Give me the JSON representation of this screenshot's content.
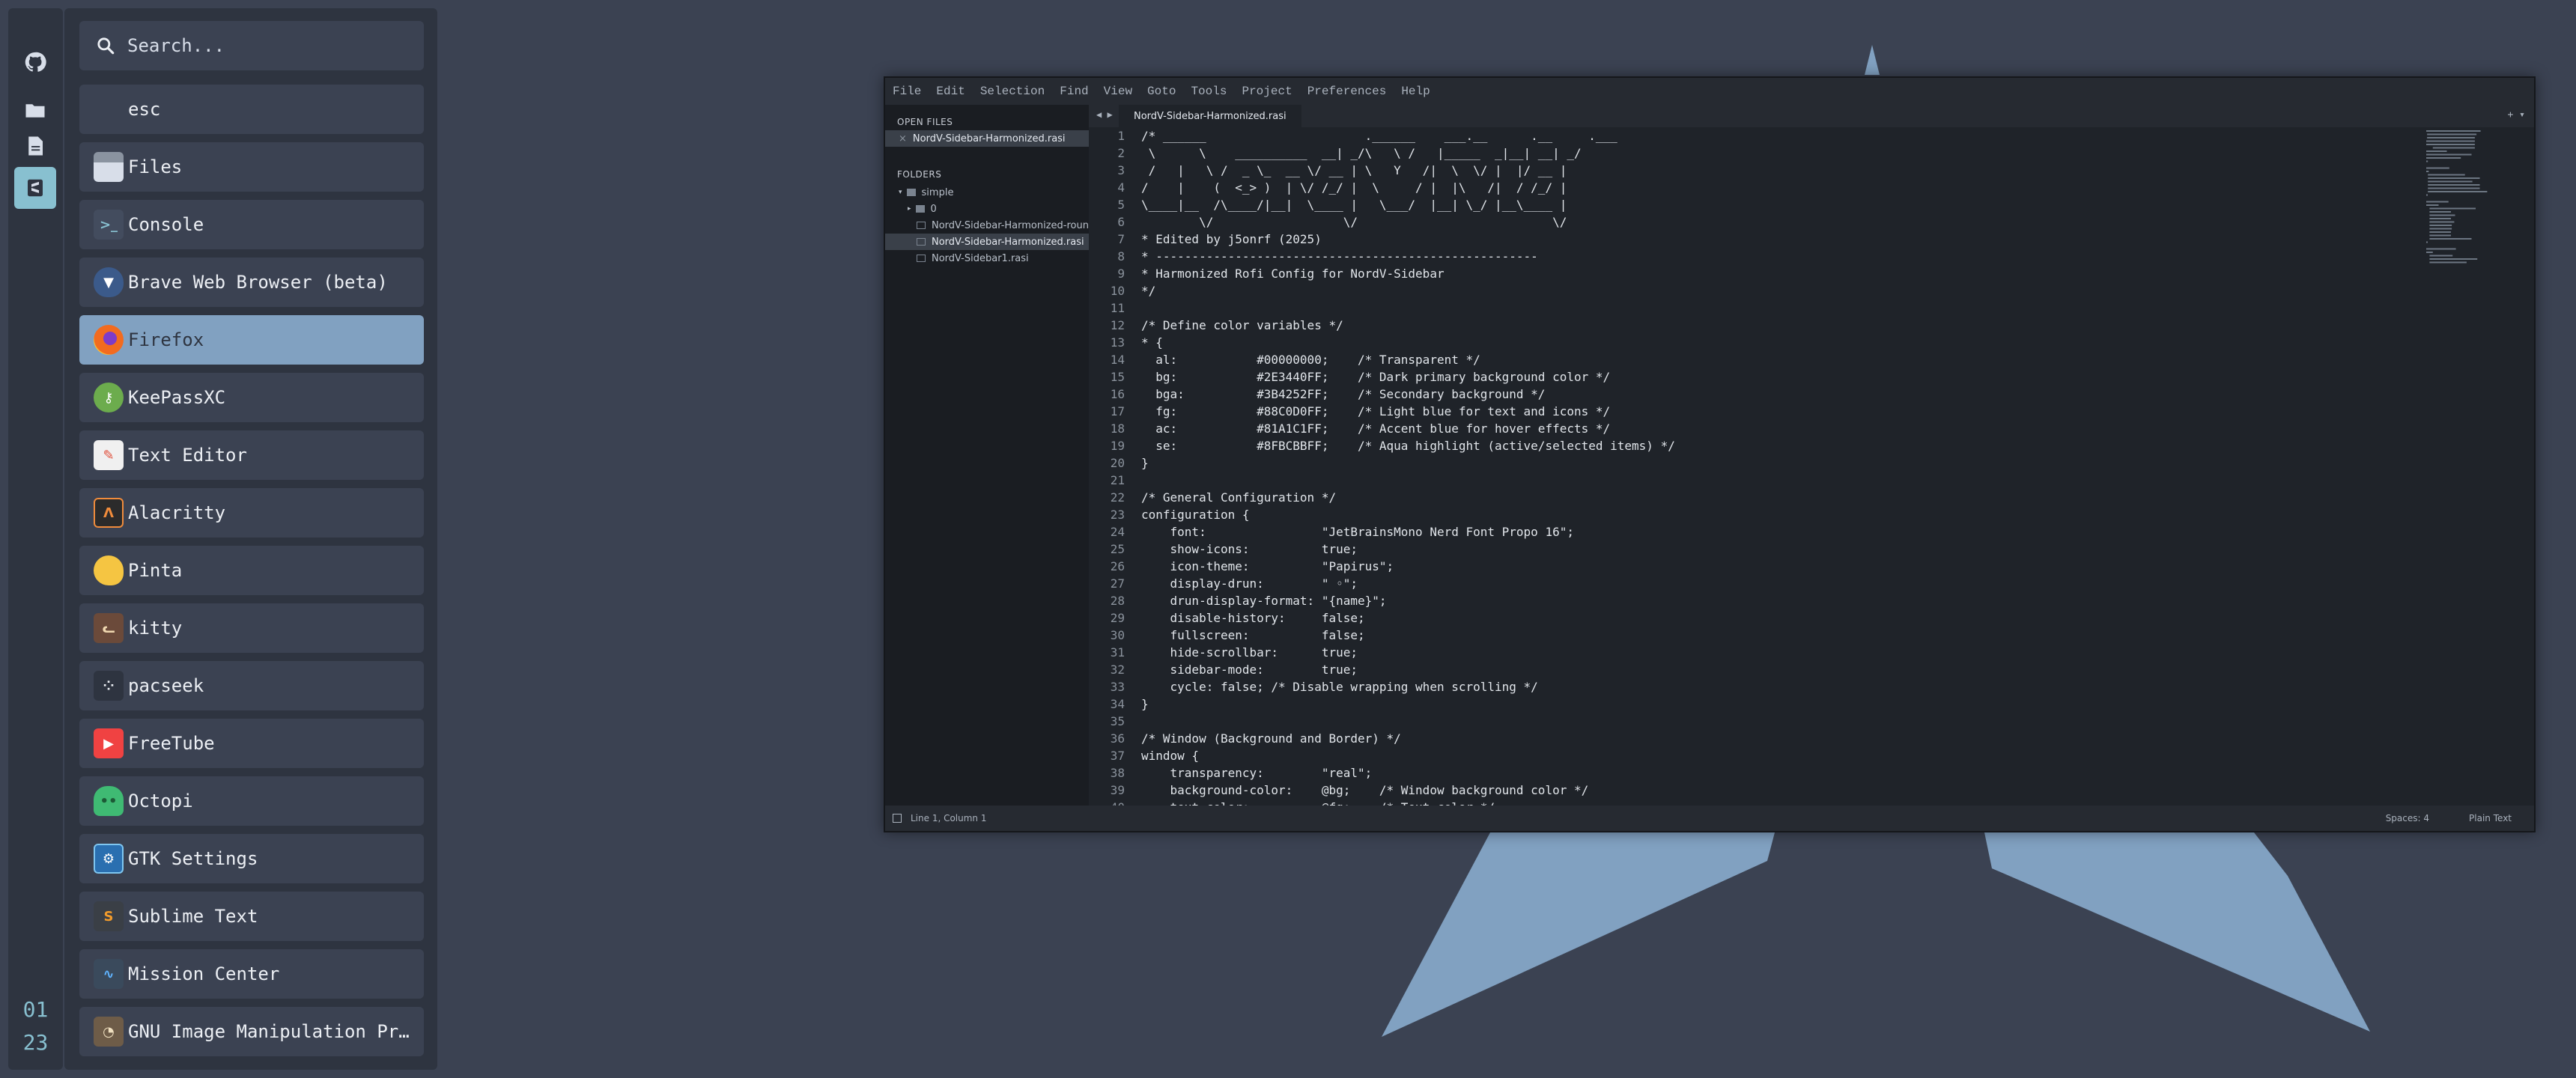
{
  "colors": {
    "bg": "#3b4252",
    "panel": "#2e3440",
    "entry": "#3b4252",
    "selected": "#81a1c1",
    "accent": "#88c0d0",
    "shape": "#81a1c1"
  },
  "sidebar": {
    "icons": [
      {
        "name": "github-icon"
      },
      {
        "name": "folder-icon"
      },
      {
        "name": "document-icon"
      },
      {
        "name": "sublime-icon"
      }
    ],
    "clock": {
      "hours": "01",
      "minutes": "23"
    }
  },
  "launcher": {
    "search": {
      "placeholder": "Search..."
    },
    "entries": [
      {
        "label": "esc"
      },
      {
        "label": "Files",
        "icon": "files-icon"
      },
      {
        "label": "Console",
        "icon": "console-icon"
      },
      {
        "label": "Brave Web Browser (beta)",
        "icon": "brave-icon"
      },
      {
        "label": "Firefox",
        "icon": "firefox-icon",
        "selected": true
      },
      {
        "label": "KeePassXC",
        "icon": "keepassxc-icon"
      },
      {
        "label": "Text Editor",
        "icon": "text-editor-icon"
      },
      {
        "label": "Alacritty",
        "icon": "alacritty-icon"
      },
      {
        "label": "Pinta",
        "icon": "pinta-icon"
      },
      {
        "label": "kitty",
        "icon": "kitty-icon"
      },
      {
        "label": "pacseek",
        "icon": "pacseek-icon"
      },
      {
        "label": "FreeTube",
        "icon": "freetube-icon"
      },
      {
        "label": "Octopi",
        "icon": "octopi-icon"
      },
      {
        "label": "GTK Settings",
        "icon": "gtk-settings-icon"
      },
      {
        "label": "Sublime Text",
        "icon": "sublime-text-icon"
      },
      {
        "label": "Mission Center",
        "icon": "mission-center-icon"
      },
      {
        "label": "GNU Image Manipulation Progr…",
        "icon": "gimp-icon"
      }
    ]
  },
  "editor": {
    "menu": [
      "File",
      "Edit",
      "Selection",
      "Find",
      "View",
      "Goto",
      "Tools",
      "Project",
      "Preferences",
      "Help"
    ],
    "sidebar": {
      "open_files_label": "OPEN FILES",
      "open_file": "NordV-Sidebar-Harmonized.rasi",
      "folders_label": "FOLDERS",
      "folder_root": "simple",
      "subfolder": "0",
      "files": [
        "NordV-Sidebar-Harmonized-round.rasi",
        "NordV-Sidebar-Harmonized.rasi",
        "NordV-Sidebar1.rasi"
      ]
    },
    "tab": "NordV-Sidebar-Harmonized.rasi",
    "code": [
      "/* ______                      .______    ___.__      .__     .___",
      " \\      \\    __________  __| _/\\   \\ /   |_____  _|__| __| _/",
      " /   |   \\ /  _ \\_  __ \\/ __ | \\   Y   /|  \\  \\/ |  |/ __ |",
      "/    |    (  <_> )  | \\/ /_/ |  \\     / |  |\\   /|  / /_/ |",
      "\\____|__  /\\____/|__|  \\____ |   \\___/  |__| \\_/ |__\\____ |",
      "        \\/                  \\/                           \\/",
      "* Edited by j5onrf (2025)",
      "* -----------------------------------------------------",
      "* Harmonized Rofi Config for NordV-Sidebar",
      "*/",
      "",
      "/* Define color variables */",
      "* {",
      "  al:           #00000000;    /* Transparent */",
      "  bg:           #2E3440FF;    /* Dark primary background color */",
      "  bga:          #3B4252FF;    /* Secondary background */",
      "  fg:           #88C0D0FF;    /* Light blue for text and icons */",
      "  ac:           #81A1C1FF;    /* Accent blue for hover effects */",
      "  se:           #8FBCBBFF;    /* Aqua highlight (active/selected items) */",
      "}",
      "",
      "/* General Configuration */",
      "configuration {",
      "    font:                \"JetBrainsMono Nerd Font Propo 16\";",
      "    show-icons:          true;",
      "    icon-theme:          \"Papirus\";",
      "    display-drun:        \" ◦\";",
      "    drun-display-format: \"{name}\";",
      "    disable-history:     false;",
      "    fullscreen:          false;",
      "    hide-scrollbar:      true;",
      "    sidebar-mode:        true;",
      "    cycle: false; /* Disable wrapping when scrolling */",
      "}",
      "",
      "/* Window (Background and Border) */",
      "window {",
      "    transparency:        \"real\";",
      "    background-color:    @bg;    /* Window background color */",
      "    text-color:          @fg;    /* Text color */"
    ],
    "status": {
      "position": "Line 1, Column 1",
      "spaces": "Spaces: 4",
      "syntax": "Plain Text"
    }
  }
}
